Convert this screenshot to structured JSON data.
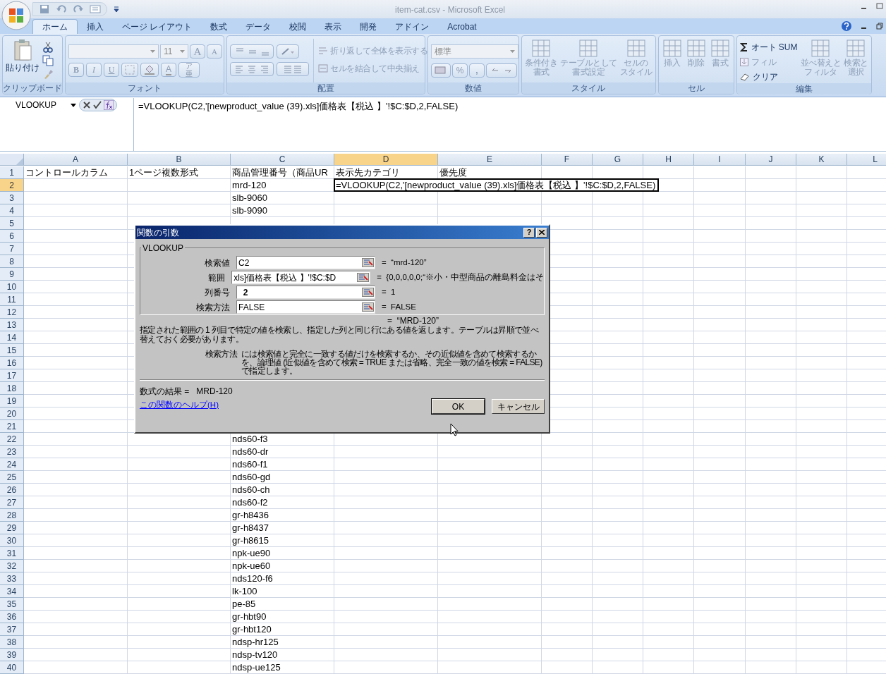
{
  "window": {
    "title": "item-cat.csv - Microsoft Excel"
  },
  "tabs": [
    {
      "label": "ホーム",
      "selected": true
    },
    {
      "label": "挿入",
      "selected": false
    },
    {
      "label": "ページ レイアウト",
      "selected": false
    },
    {
      "label": "数式",
      "selected": false
    },
    {
      "label": "データ",
      "selected": false
    },
    {
      "label": "校閲",
      "selected": false
    },
    {
      "label": "表示",
      "selected": false
    },
    {
      "label": "開発",
      "selected": false
    },
    {
      "label": "アドイン",
      "selected": false
    },
    {
      "label": "Acrobat",
      "selected": false
    }
  ],
  "ribbon": {
    "groups": [
      {
        "kind": "clipboard",
        "label": "クリップボード",
        "paste": {
          "label": "貼り付け",
          "disabled": false
        }
      },
      {
        "kind": "font",
        "label": "フォント",
        "font_size": "11",
        "grow": "A",
        "shrink": "A",
        "bold": "B",
        "italic": "I",
        "underline": "U",
        "font_color": "A",
        "phonetic_ruby": "ア",
        "phonetic": "亜"
      },
      {
        "kind": "alignment",
        "label": "配置",
        "wrap": {
          "label": "折り返して全体を表示する",
          "disabled": true
        },
        "merge": {
          "label": "セルを結合して中央揃え",
          "disabled": true
        }
      },
      {
        "kind": "number",
        "label": "数値",
        "format": "標準",
        "percent": "%",
        "comma": ","
      },
      {
        "kind": "big_buttons",
        "label": "スタイル",
        "items": [
          {
            "lines": [
              "条件付き",
              "書式"
            ],
            "disabled": true
          },
          {
            "lines": [
              "テーブルとして",
              "書式設定"
            ],
            "disabled": true
          },
          {
            "lines": [
              "セルの",
              "スタイル"
            ],
            "disabled": true
          }
        ]
      },
      {
        "kind": "big_buttons",
        "label": "セル",
        "items": [
          {
            "lines": [
              "挿入"
            ],
            "disabled": true
          },
          {
            "lines": [
              "削除"
            ],
            "disabled": true
          },
          {
            "lines": [
              "書式"
            ],
            "disabled": true
          }
        ]
      },
      {
        "kind": "editing",
        "label": "編集",
        "autosum": {
          "label": "オート SUM",
          "disabled": false
        },
        "fill": {
          "label": "フィル",
          "disabled": true
        },
        "clear": {
          "label": "クリア",
          "disabled": false
        },
        "sort": {
          "lines": [
            "並べ替えと",
            "フィルタ"
          ],
          "disabled": true
        },
        "find": {
          "lines": [
            "検索と",
            "選択"
          ],
          "disabled": true
        }
      }
    ]
  },
  "formula_bar": {
    "name_box": "VLOOKUP",
    "formula": "=VLOOKUP(C2,'[newproduct_value (39).xls]価格表【税込 】'!$C:$D,2,FALSE)"
  },
  "columns": [
    {
      "label": "A",
      "selected": false
    },
    {
      "label": "B",
      "selected": false
    },
    {
      "label": "C",
      "selected": false
    },
    {
      "label": "D",
      "selected": true
    },
    {
      "label": "E",
      "selected": false
    },
    {
      "label": "F",
      "selected": false
    },
    {
      "label": "G",
      "selected": false
    },
    {
      "label": "H",
      "selected": false
    },
    {
      "label": "I",
      "selected": false
    },
    {
      "label": "J",
      "selected": false
    },
    {
      "label": "K",
      "selected": false
    },
    {
      "label": "L",
      "selected": false
    }
  ],
  "rows": [
    {
      "number": "1",
      "selected": false,
      "cells": {
        "A": {
          "text": "コントロールカラム",
          "active": false
        },
        "B": {
          "text": "1ページ複数形式",
          "active": false
        },
        "C": {
          "text": "商品管理番号（商品UR",
          "active": false
        },
        "D": {
          "text": "表示先カテゴリ",
          "active": false
        },
        "E": {
          "text": "優先度",
          "active": false
        }
      }
    },
    {
      "number": "2",
      "selected": true,
      "cells": {
        "C": {
          "text": "mrd-120",
          "active": false
        },
        "D": {
          "text": "=VLOOKUP(C2,'[newproduct_value (39).xls]価格表【税込 】'!$C:$D,2,FALSE)",
          "active": true
        }
      }
    },
    {
      "number": "3",
      "selected": false,
      "cells": {
        "C": {
          "text": "slb-9060",
          "active": false
        }
      }
    },
    {
      "number": "4",
      "selected": false,
      "cells": {
        "C": {
          "text": "slb-9090",
          "active": false
        }
      }
    },
    {
      "number": "5",
      "selected": false
    },
    {
      "number": "6",
      "selected": false
    },
    {
      "number": "7",
      "selected": false
    },
    {
      "number": "8",
      "selected": false
    },
    {
      "number": "9",
      "selected": false
    },
    {
      "number": "10",
      "selected": false
    },
    {
      "number": "11",
      "selected": false
    },
    {
      "number": "12",
      "selected": false
    },
    {
      "number": "13",
      "selected": false
    },
    {
      "number": "14",
      "selected": false
    },
    {
      "number": "15",
      "selected": false
    },
    {
      "number": "16",
      "selected": false
    },
    {
      "number": "17",
      "selected": false
    },
    {
      "number": "18",
      "selected": false
    },
    {
      "number": "19",
      "selected": false
    },
    {
      "number": "20",
      "selected": false
    },
    {
      "number": "21",
      "selected": false
    },
    {
      "number": "22",
      "selected": false,
      "cells": {
        "C": {
          "text": "nds60-f3",
          "active": false
        }
      }
    },
    {
      "number": "23",
      "selected": false,
      "cells": {
        "C": {
          "text": "nds60-dr",
          "active": false
        }
      }
    },
    {
      "number": "24",
      "selected": false,
      "cells": {
        "C": {
          "text": "nds60-f1",
          "active": false
        }
      }
    },
    {
      "number": "25",
      "selected": false,
      "cells": {
        "C": {
          "text": "nds60-gd",
          "active": false
        }
      }
    },
    {
      "number": "26",
      "selected": false,
      "cells": {
        "C": {
          "text": "nds60-ch",
          "active": false
        }
      }
    },
    {
      "number": "27",
      "selected": false,
      "cells": {
        "C": {
          "text": "nds60-f2",
          "active": false
        }
      }
    },
    {
      "number": "28",
      "selected": false,
      "cells": {
        "C": {
          "text": "gr-h8436",
          "active": false
        }
      }
    },
    {
      "number": "29",
      "selected": false,
      "cells": {
        "C": {
          "text": "gr-h8437",
          "active": false
        }
      }
    },
    {
      "number": "30",
      "selected": false,
      "cells": {
        "C": {
          "text": "gr-h8615",
          "active": false
        }
      }
    },
    {
      "number": "31",
      "selected": false,
      "cells": {
        "C": {
          "text": "npk-ue90",
          "active": false
        }
      }
    },
    {
      "number": "32",
      "selected": false,
      "cells": {
        "C": {
          "text": "npk-ue60",
          "active": false
        }
      }
    },
    {
      "number": "33",
      "selected": false,
      "cells": {
        "C": {
          "text": "nds120-f6",
          "active": false
        }
      }
    },
    {
      "number": "34",
      "selected": false,
      "cells": {
        "C": {
          "text": "lk-100",
          "active": false
        }
      }
    },
    {
      "number": "35",
      "selected": false,
      "cells": {
        "C": {
          "text": "pe-85",
          "active": false
        }
      }
    },
    {
      "number": "36",
      "selected": false,
      "cells": {
        "C": {
          "text": "gr-hbt90",
          "active": false
        }
      }
    },
    {
      "number": "37",
      "selected": false,
      "cells": {
        "C": {
          "text": "gr-hbt120",
          "active": false
        }
      }
    },
    {
      "number": "38",
      "selected": false,
      "cells": {
        "C": {
          "text": "ndsp-hr125",
          "active": false
        }
      }
    },
    {
      "number": "39",
      "selected": false,
      "cells": {
        "C": {
          "text": "ndsp-tv120",
          "active": false
        }
      }
    },
    {
      "number": "40",
      "selected": false,
      "cells": {
        "C": {
          "text": "ndsp-ue125",
          "active": false
        }
      }
    }
  ],
  "dialog": {
    "title": "関数の引数",
    "help_button": "?",
    "function_name": "VLOOKUP",
    "arguments": [
      {
        "label": "検索値",
        "value": "C2",
        "result": "=  “mrd-120”"
      },
      {
        "label": "範囲",
        "value": "xls]価格表【税込 】'!$C:$D",
        "result": "=  {0,0,0,0,0;“※小・中型商品の離島料金はそ"
      },
      {
        "label": "列番号",
        "value": "  2",
        "result": "=  1"
      },
      {
        "label": "検索方法",
        "value": "FALSE",
        "result": "=  FALSE"
      }
    ],
    "overall_result": "=  “MRD-120”",
    "description": "指定された範囲の 1 列目で特定の値を検索し、指定した列と同じ行にある値を返します。テーブルは昇順で並べ替えておく必要があります。",
    "argument_help_label": "検索方法",
    "argument_help": "には検索値と完全に一致する値だけを検索するか、その近似値を含めて検索するかを、論理値 (近似値を含めて検索 = TRUE または省略、完全一致の値を検索 = FALSE) で指定します。",
    "formula_result": "数式の結果 =   MRD-120",
    "help_link": "この関数のヘルプ(H)",
    "buttons": [
      "OK",
      "キャンセル"
    ]
  }
}
